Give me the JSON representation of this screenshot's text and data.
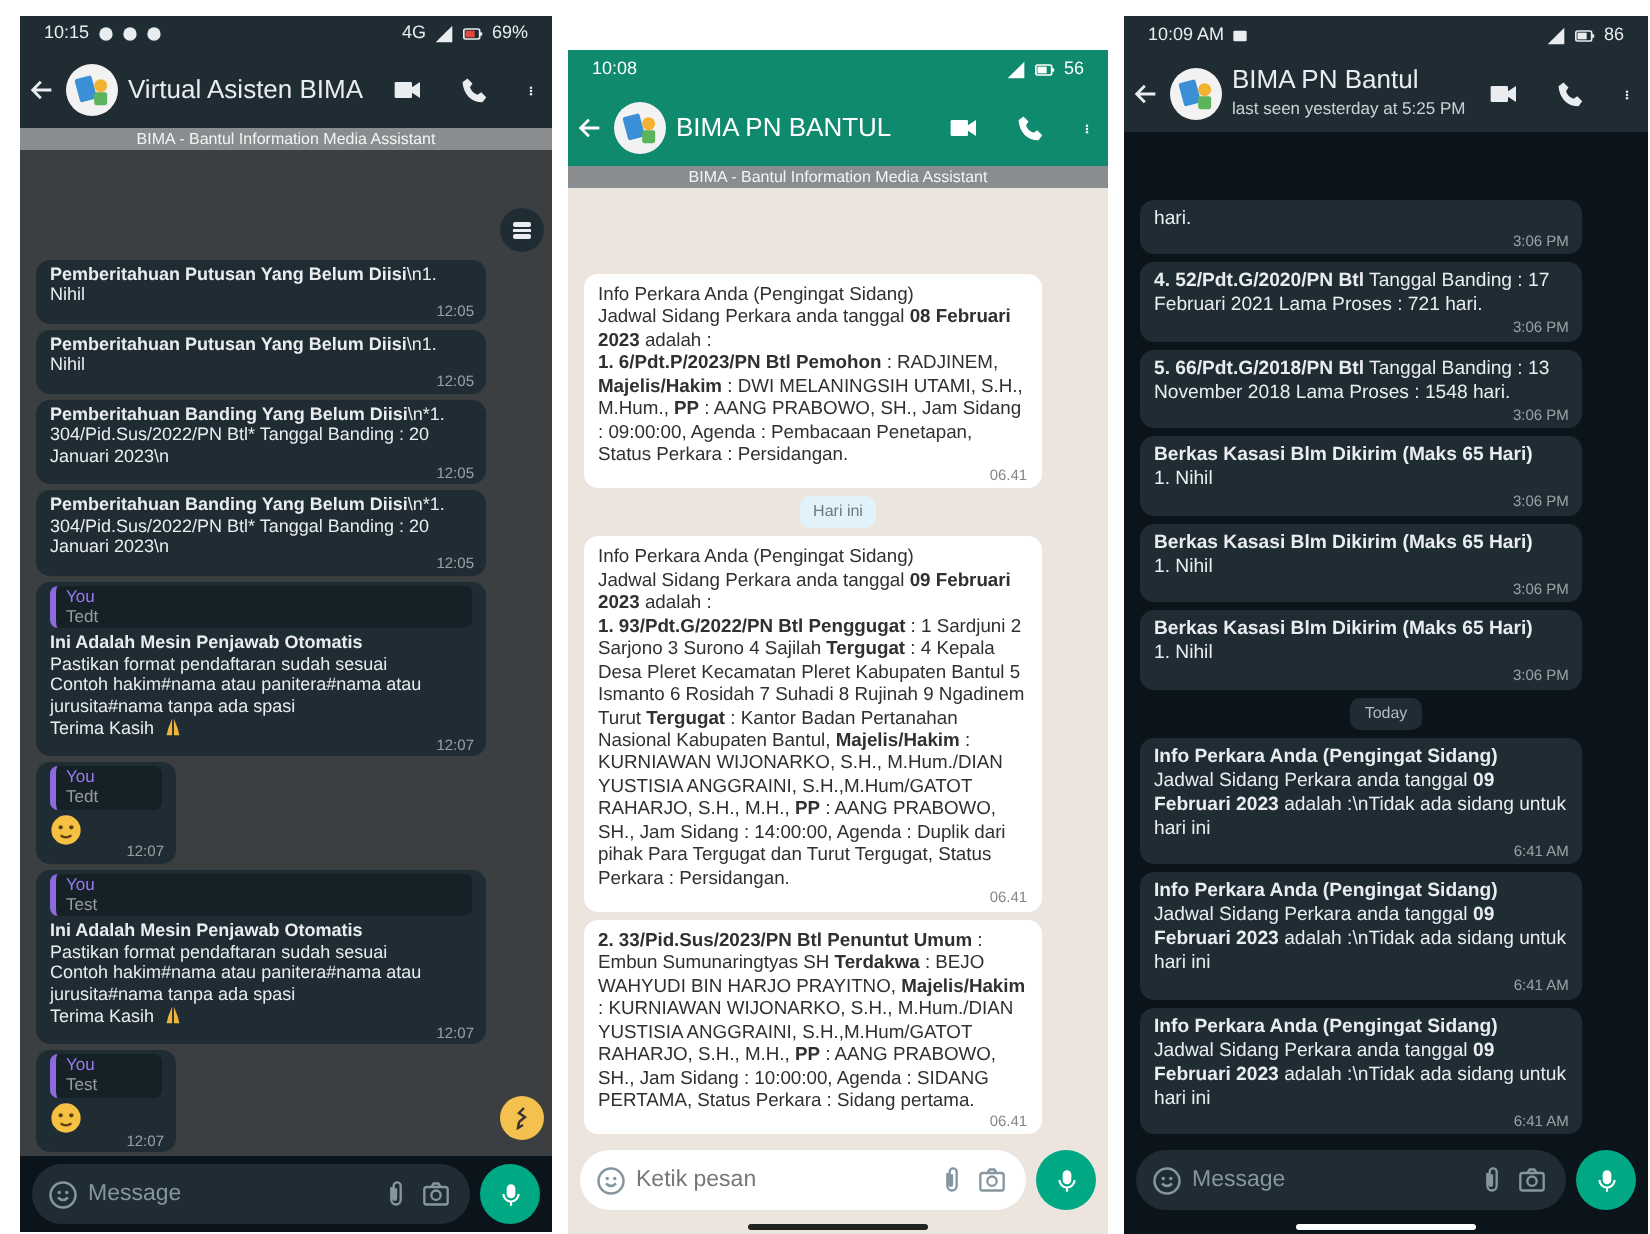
{
  "phones": [
    {
      "status_bar": {
        "time": "10:15",
        "network": "4G",
        "battery": "69%"
      },
      "header": {
        "title": "Virtual Asisten BIMA"
      },
      "banner": "BIMA - Bantul Information Media Assistant",
      "floating_buttons": true,
      "messages": [
        {
          "kind": "text",
          "lines": [
            "**Pemberitahuan Putusan Yang Belum Diisi**\\n1. Nihil"
          ],
          "time": "12:05"
        },
        {
          "kind": "text",
          "lines": [
            "**Pemberitahuan Putusan Yang Belum Diisi**\\n1. Nihil"
          ],
          "time": "12:05"
        },
        {
          "kind": "text",
          "lines": [
            "**Pemberitahuan Banding Yang Belum Diisi**\\n*1. 304/Pid.Sus/2022/PN Btl*  Tanggal Banding : 20 Januari 2023\\n"
          ],
          "time": "12:05"
        },
        {
          "kind": "text",
          "lines": [
            "**Pemberitahuan Banding Yang Belum Diisi**\\n*1. 304/Pid.Sus/2022/PN Btl*  Tanggal Banding : 20 Januari 2023\\n"
          ],
          "time": "12:05"
        },
        {
          "kind": "reply",
          "quote": {
            "author": "You",
            "text": "Tedt"
          },
          "lines": [
            "**Ini Adalah Mesin Penjawab Otomatis**",
            "Pastikan format pendaftaran sudah sesuai",
            "Contoh hakim#nama atau panitera#nama atau jurusita#nama tanpa ada spasi",
            "Terima Kasih"
          ],
          "thanks_icon": true,
          "time": "12:07"
        },
        {
          "kind": "sticker",
          "quote": {
            "author": "You",
            "text": "Tedt"
          },
          "time": "12:07"
        },
        {
          "kind": "reply",
          "quote": {
            "author": "You",
            "text": "Test"
          },
          "lines": [
            "**Ini Adalah Mesin Penjawab Otomatis**",
            "Pastikan format pendaftaran sudah sesuai",
            "Contoh hakim#nama atau panitera#nama atau jurusita#nama tanpa ada spasi",
            "Terima Kasih"
          ],
          "thanks_icon": true,
          "time": "12:07"
        },
        {
          "kind": "sticker",
          "quote": {
            "author": "You",
            "text": "Test"
          },
          "time": "12:07"
        }
      ],
      "composer": {
        "placeholder": "Message"
      }
    },
    {
      "status_bar": {
        "time": "10:08",
        "battery": "56"
      },
      "header": {
        "title": "BIMA PN BANTUL"
      },
      "banner": "BIMA - Bantul Information Media Assistant",
      "floating_buttons": false,
      "messages": [
        {
          "kind": "text",
          "lines": [
            "Info Perkara Anda (Pengingat Sidang)",
            "Jadwal Sidang Perkara anda tanggal **08 Februari 2023** adalah :",
            "**1. 6/Pdt.P/2023/PN Btl Pemohon** : RADJINEM, **Majelis/Hakim** : DWI MELANINGSIH UTAMI, S.H., M.Hum., **PP** : AANG PRABOWO, SH., Jam Sidang : 09:00:00, Agenda : Pembacaan Penetapan, Status Perkara : Persidangan."
          ],
          "time": "06.41"
        },
        {
          "kind": "date",
          "text": "Hari ini"
        },
        {
          "kind": "text",
          "lines": [
            "Info Perkara Anda (Pengingat Sidang)",
            "Jadwal Sidang Perkara anda tanggal **09 Februari 2023** adalah :",
            "**1. 93/Pdt.G/2022/PN Btl Penggugat** : 1 Sardjuni 2 Sarjono 3 Surono 4 Sajilah **Tergugat** : 4 Kepala Desa Pleret  Kecamatan Pleret  Kabupaten Bantul 5 Ismanto 6 Rosidah 7 Suhadi 8 Rujinah 9 Ngadinem Turut **Tergugat** : Kantor Badan Pertanahan Nasional Kabupaten Bantul, **Majelis/Hakim** : KURNIAWAN WIJONARKO, S.H., M.Hum./DIAN YUSTISIA ANGGRAINI, S.H.,M.Hum/GATOT RAHARJO, S.H., M.H., **PP** : AANG PRABOWO, SH., Jam Sidang : 14:00:00, Agenda : Duplik dari pihak Para Tergugat dan Turut Tergugat, Status Perkara : Persidangan."
          ],
          "time": "06.41"
        },
        {
          "kind": "text",
          "lines": [
            "**2. 33/Pid.Sus/2023/PN Btl Penuntut Umum** : Embun Sumunaringtyas  SH  **Terdakwa** : BEJO WAHYUDI BIN HARJO PRAYITNO, **Majelis/Hakim** : KURNIAWAN WIJONARKO, S.H., M.Hum./DIAN YUSTISIA ANGGRAINI, S.H.,M.Hum/GATOT RAHARJO, S.H., M.H., **PP** : AANG PRABOWO, SH., Jam Sidang : 10:00:00, Agenda : SIDANG PERTAMA, Status Perkara : Sidang pertama."
          ],
          "time": "06.41"
        }
      ],
      "composer": {
        "placeholder": "Ketik pesan"
      }
    },
    {
      "status_bar": {
        "time": "10:09 AM",
        "battery": "86"
      },
      "header": {
        "title": "BIMA PN Bantul",
        "subtitle": "last seen yesterday at 5:25 PM"
      },
      "floating_buttons": false,
      "messages": [
        {
          "kind": "text",
          "lines": [
            "hari."
          ],
          "time": "3:06 PM"
        },
        {
          "kind": "text",
          "lines": [
            "**4. 52/Pdt.G/2020/PN Btl**  Tanggal Banding : 17 Februari 2021 Lama Proses : 721 hari."
          ],
          "time": "3:06 PM"
        },
        {
          "kind": "text",
          "lines": [
            "**5. 66/Pdt.G/2018/PN Btl**  Tanggal Banding : 13 November 2018 Lama Proses : 1548 hari."
          ],
          "time": "3:06 PM"
        },
        {
          "kind": "text",
          "lines": [
            "**Berkas Kasasi Blm Dikirim (Maks 65 Hari)**",
            "1. Nihil"
          ],
          "time": "3:06 PM"
        },
        {
          "kind": "text",
          "lines": [
            "**Berkas Kasasi Blm Dikirim (Maks 65 Hari)**",
            "1. Nihil"
          ],
          "time": "3:06 PM"
        },
        {
          "kind": "text",
          "lines": [
            "**Berkas Kasasi Blm Dikirim (Maks 65 Hari)**",
            "1. Nihil"
          ],
          "time": "3:06 PM"
        },
        {
          "kind": "date",
          "text": "Today"
        },
        {
          "kind": "text",
          "lines": [
            "**Info Perkara Anda (Pengingat Sidang)**",
            "Jadwal Sidang Perkara anda tanggal **09 Februari 2023** adalah :\\nTidak ada sidang untuk hari ini"
          ],
          "time": "6:41 AM"
        },
        {
          "kind": "text",
          "lines": [
            "**Info Perkara Anda (Pengingat Sidang)**",
            "Jadwal Sidang Perkara anda tanggal **09 Februari 2023** adalah :\\nTidak ada sidang untuk hari ini"
          ],
          "time": "6:41 AM"
        },
        {
          "kind": "text",
          "lines": [
            "**Info Perkara Anda (Pengingat Sidang)**",
            "Jadwal Sidang Perkara anda tanggal **09 Februari 2023** adalah :\\nTidak ada sidang untuk hari ini"
          ],
          "time": "6:41 AM"
        }
      ],
      "composer": {
        "placeholder": "Message"
      }
    }
  ]
}
